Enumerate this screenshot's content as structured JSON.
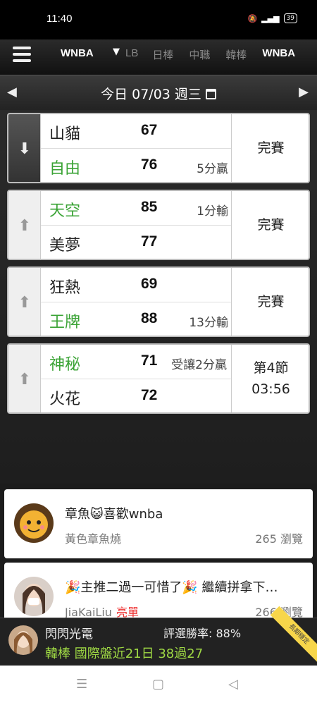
{
  "status_bar": {
    "time": "11:40",
    "battery": "39"
  },
  "nav": {
    "current_league": "WNBA",
    "tabs": [
      "LB",
      "日棒",
      "中職",
      "韓棒",
      "WNBA"
    ]
  },
  "date_bar": {
    "date": "今日 07/03 週三"
  },
  "games": [
    {
      "home": "山貓",
      "home_score": "67",
      "home_note": "",
      "away": "自由",
      "away_score": "76",
      "away_note": "5分贏",
      "status": "完賽"
    },
    {
      "home": "天空",
      "home_score": "85",
      "home_note": "1分輸",
      "away": "美夢",
      "away_score": "77",
      "away_note": "",
      "status": "完賽"
    },
    {
      "home": "狂熱",
      "home_score": "69",
      "home_note": "",
      "away": "王牌",
      "away_score": "88",
      "away_note": "13分輸",
      "status": "完賽"
    },
    {
      "home": "神秘",
      "home_score": "71",
      "home_note": "受讓2分贏",
      "away": "火花",
      "away_score": "72",
      "away_note": "",
      "status": "第4節\n03:56"
    }
  ],
  "posts": [
    {
      "title": "章魚😺喜歡wnba",
      "author": "黃色章魚燒",
      "tag": "",
      "views": "265 瀏覽"
    },
    {
      "title": "🎉主推二過一可惜了🎉 繼續拼拿下…",
      "author": "JiaKaiLiu",
      "tag": "亮單",
      "views": "266 瀏覽"
    }
  ],
  "banner": {
    "name": "閃閃光電",
    "rate": "評選勝率: 88%",
    "record": "韓棒 國際盤近21日 38過27",
    "ribbon": "長期穩定"
  },
  "colors": {
    "win_team": "#3aa335",
    "record": "#9fd944",
    "hot_tag": "#e33333"
  }
}
